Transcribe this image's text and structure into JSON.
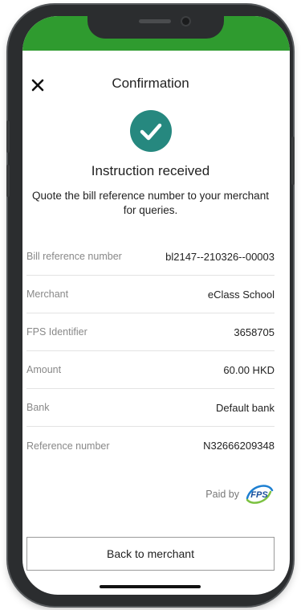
{
  "header": {
    "title": "Confirmation",
    "close_icon": "close-icon"
  },
  "theme": {
    "status_bar_color": "#2f9b2f",
    "success_color": "#26887f",
    "frame_color": "#2b2d2f"
  },
  "status": {
    "icon": "check-circle-icon",
    "title": "Instruction received",
    "description": "Quote the bill reference number to your merchant for queries."
  },
  "details": [
    {
      "label": "Bill reference number",
      "value": "bl2147--210326--00003"
    },
    {
      "label": "Merchant",
      "value": "eClass School"
    },
    {
      "label": "FPS Identifier",
      "value": "3658705"
    },
    {
      "label": "Amount",
      "value": "60.00 HKD"
    },
    {
      "label": "Bank",
      "value": "Default bank"
    },
    {
      "label": "Reference number",
      "value": "N32666209348"
    }
  ],
  "paid_by": {
    "label": "Paid by",
    "logo_text": "FPS"
  },
  "actions": {
    "back_label": "Back to merchant"
  }
}
